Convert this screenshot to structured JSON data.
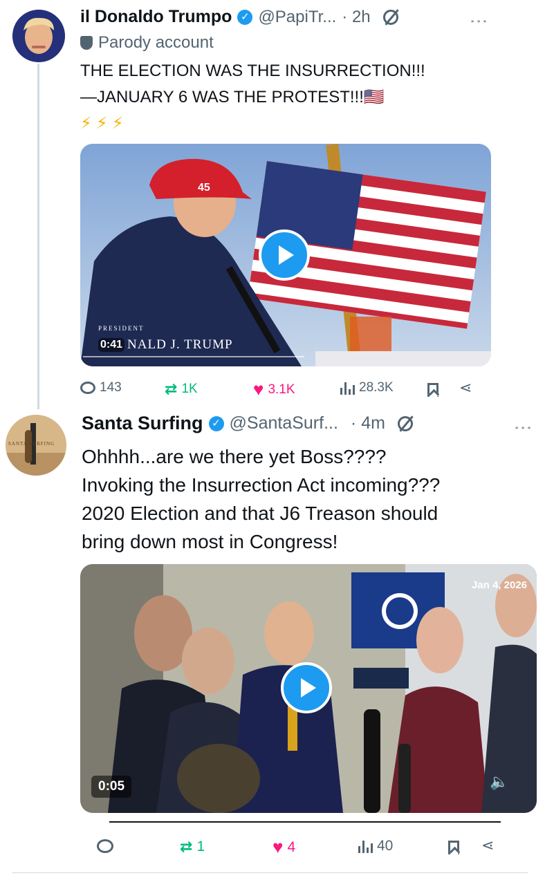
{
  "tweet1": {
    "display_name": "il Donaldo Trumpo",
    "handle": "@PapiTr...",
    "time": "· 2h",
    "label": "Parody account",
    "text_line1": "THE ELECTION WAS THE INSURRECTION!!!",
    "text_line2": "—JANUARY 6 WAS THE PROTEST!!!🇺🇸",
    "emoji_line": "⚡⚡⚡",
    "video": {
      "duration": "0:41",
      "caption": "NALD J. TRUMP",
      "caption_small": "PRESIDENT",
      "cap_text": "45"
    },
    "actions": {
      "replies": "143",
      "reposts": "1K",
      "likes": "3.1K",
      "views": "28.3K"
    }
  },
  "tweet2": {
    "display_name": "Santa Surfing",
    "handle": "@SantaSurf...",
    "time": "· 4m",
    "avatar_text": "SANTA SURFING",
    "text": [
      "Ohhhh...are we there yet Boss????",
      "Invoking the Insurrection Act incoming???",
      "2020 Election and that J6 Treason should",
      "bring down most in Congress!"
    ],
    "video": {
      "date_stamp": "Jan 4, 2026",
      "duration": "0:05"
    },
    "actions": {
      "replies": "",
      "reposts": "1",
      "likes": "4",
      "views": "40"
    }
  },
  "colors": {
    "accent": "#1d9bf0",
    "like": "#f91880",
    "repost": "#00ba7c",
    "muted": "#536471"
  },
  "icons": [
    "verified-icon",
    "grok-icon",
    "more-icon",
    "parody-icon",
    "reply-icon",
    "repost-icon",
    "like-icon",
    "views-icon",
    "bookmark-icon",
    "share-icon",
    "play-icon",
    "mute-icon"
  ]
}
